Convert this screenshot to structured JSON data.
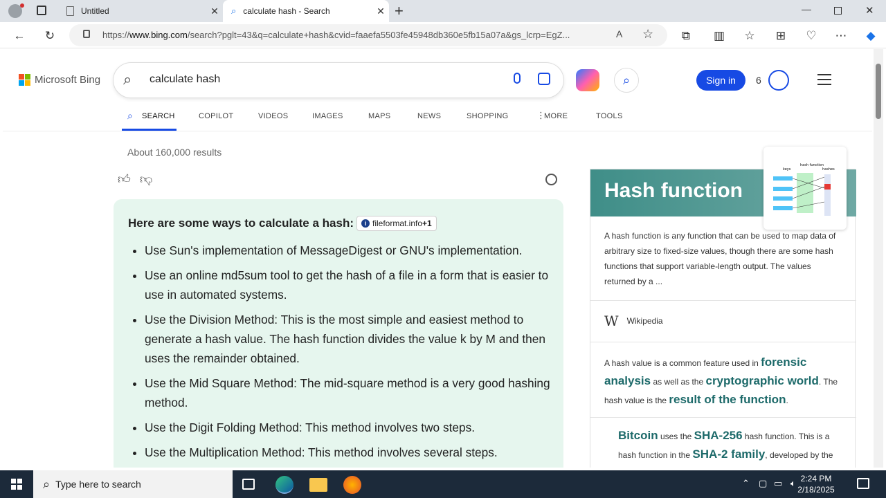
{
  "browser": {
    "tabs": [
      {
        "title": "Untitled",
        "active": false
      },
      {
        "title": "calculate hash - Search",
        "active": true
      }
    ],
    "url_prefix": "https://",
    "url_domain": "www.bing.com",
    "url_rest": "/search?pglt=43&q=calculate+hash&cvid=faaefa5503fe45948db360e5fb15a07a&gs_lcrp=EgZ..."
  },
  "bing": {
    "logo_text": "Microsoft Bing",
    "query": "calculate hash",
    "sign_in": "Sign in",
    "rewards_count": "6",
    "nav": [
      "SEARCH",
      "COPILOT",
      "VIDEOS",
      "IMAGES",
      "MAPS",
      "NEWS",
      "SHOPPING",
      "MORE",
      "TOOLS"
    ],
    "result_count": "About 160,000 results"
  },
  "answer": {
    "heading": "Here are some ways to calculate a hash:",
    "citation": "fileformat.info",
    "citation_more": "+1",
    "items": [
      "Use Sun's implementation of MessageDigest or GNU's implementation.",
      "Use an online md5sum tool to get the hash of a file in a form that is easier to use in automated systems.",
      "Use the Division Method: This is the most simple and easiest method to generate a hash value. The hash function divides the value k by M and then uses the remainder obtained.",
      "Use the Mid Square Method: The mid-square method is a very good hashing method.",
      "Use the Digit Folding Method: This method involves two steps.",
      "Use the Multiplication Method: This method involves several steps."
    ]
  },
  "knowledge_panel": {
    "title": "Hash function",
    "description": "A hash function is any function that can be used to map data of arbitrary size to fixed-size values, though there are some hash functions that support variable-length output. The values returned by a ...",
    "source": "Wikipedia",
    "diagram_labels": {
      "keys": "keys",
      "function": "hash function",
      "hashes": "hashes"
    },
    "fact1": {
      "a": "A hash value is a common feature used in ",
      "h1": "forensic analysis",
      "b": " as well as the ",
      "h2": "cryptographic world",
      "c": ". The hash value is the ",
      "h3": "result of the function",
      "d": "."
    },
    "fact2": {
      "h1": "Bitcoin",
      "a": " uses the ",
      "h2": "SHA-256",
      "b": " hash function. This is a hash function in the ",
      "h3": "SHA-2 family",
      "c": ", developed by the"
    }
  },
  "taskbar": {
    "search_placeholder": "Type here to search",
    "time": "2:24 PM",
    "date": "2/18/2025"
  },
  "colors": {
    "bing_blue": "#174ae4",
    "answer_bg": "#e6f6ee",
    "kp_header": "#3f8e88"
  }
}
